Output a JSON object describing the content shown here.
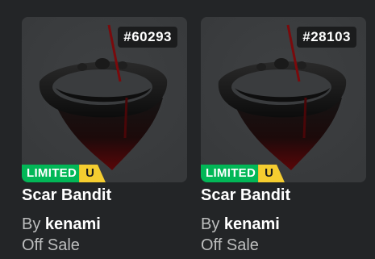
{
  "items": [
    {
      "serial": "#60293",
      "badge_limited": "LIMITED",
      "badge_u": "U",
      "name": "Scar Bandit",
      "by_label": "By",
      "creator": "kenami",
      "price": "Off Sale"
    },
    {
      "serial": "#28103",
      "badge_limited": "LIMITED",
      "badge_u": "U",
      "name": "Scar Bandit",
      "by_label": "By",
      "creator": "kenami",
      "price": "Off Sale"
    }
  ],
  "colors": {
    "background": "#232527",
    "card": "#393b3d",
    "limited_green": "#02b757",
    "unique_yellow": "#f5cd30",
    "muted_text": "#bdbebe"
  },
  "icons": {
    "thumbnail": "scar-bandit-bandana-icon"
  }
}
